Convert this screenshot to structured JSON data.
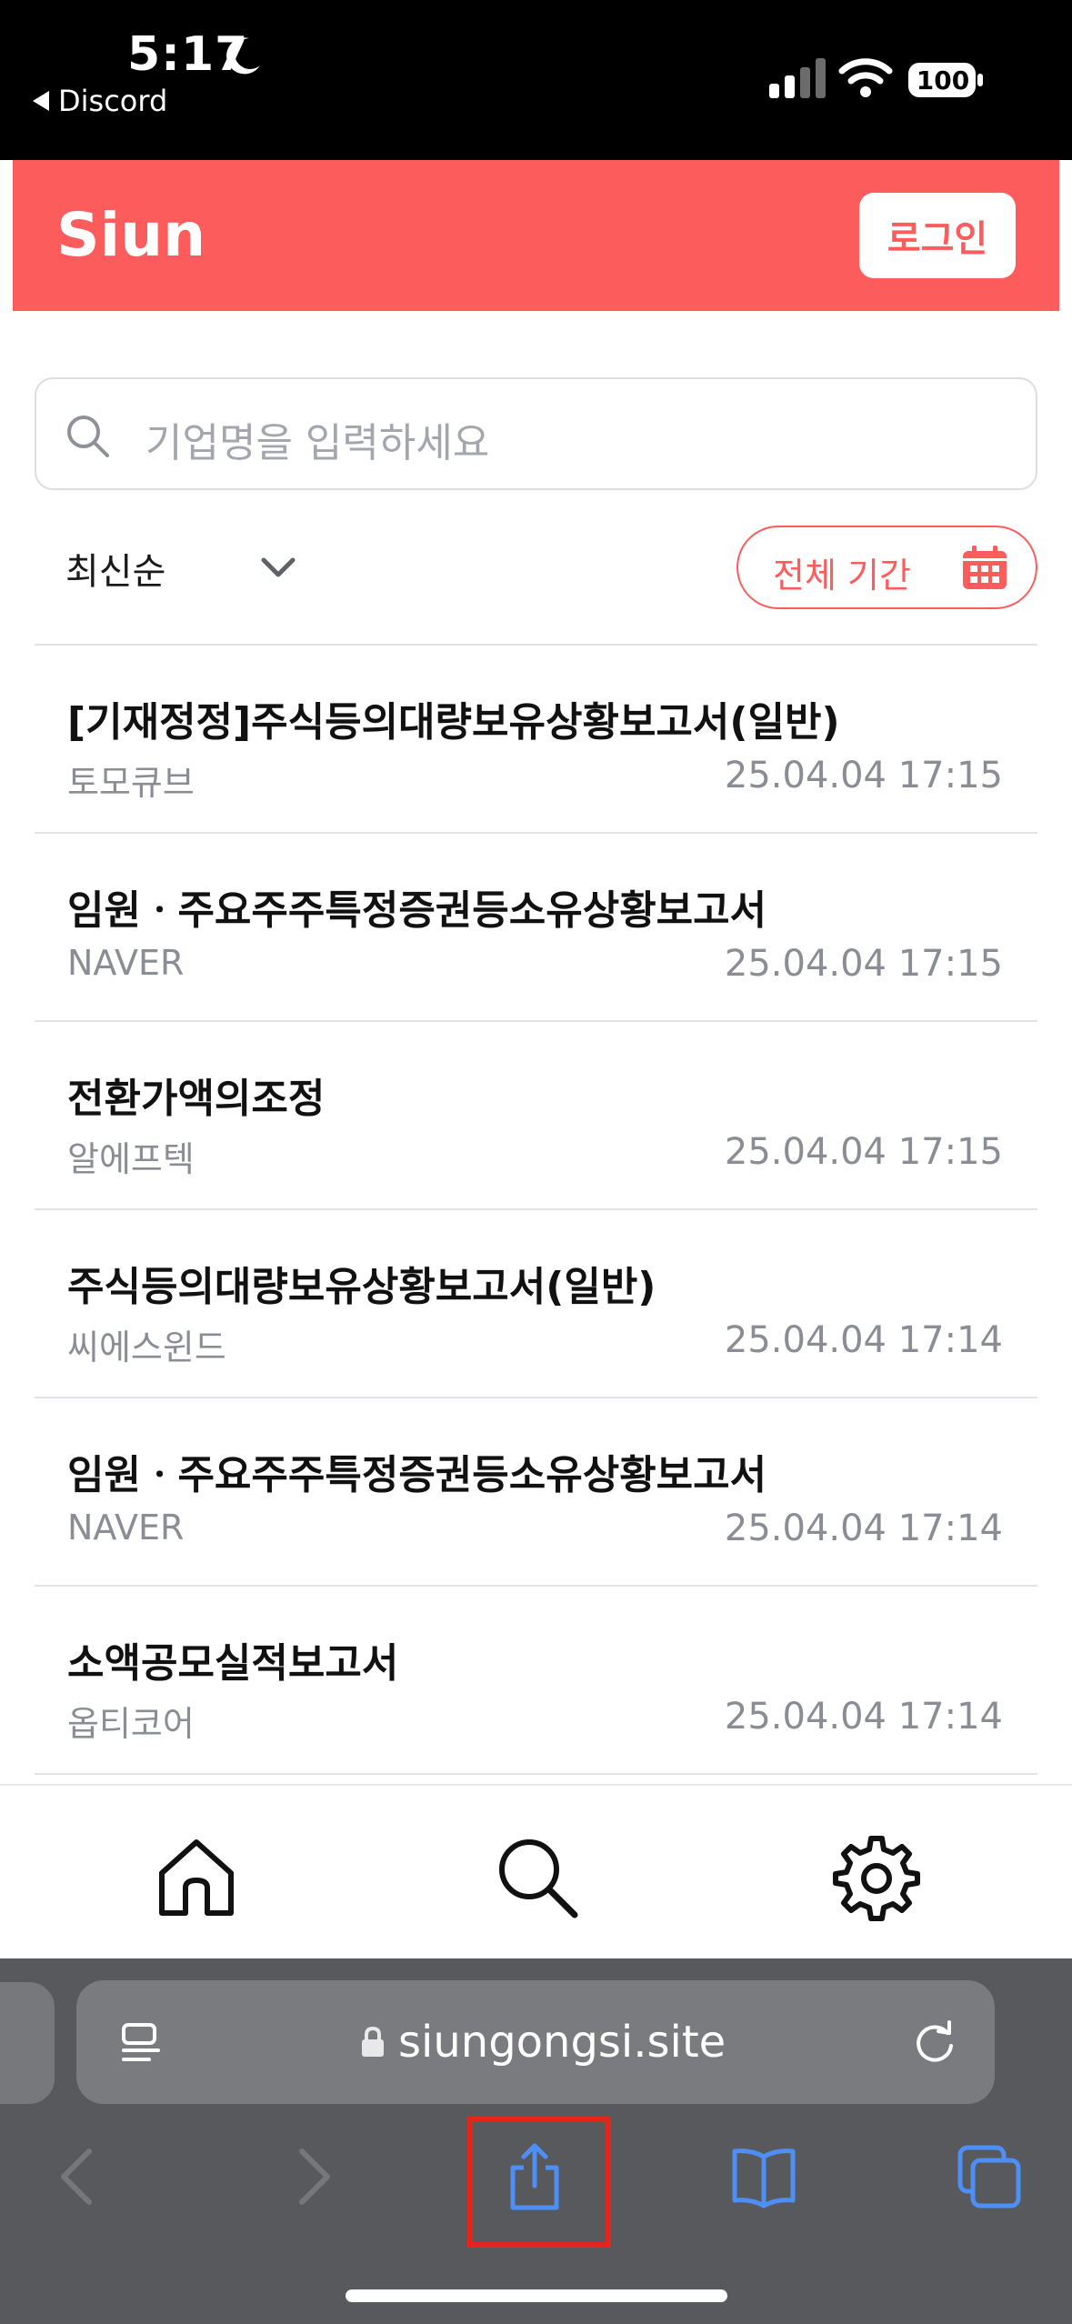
{
  "status_bar": {
    "time": "5:17",
    "back_app": "Discord",
    "battery": "100"
  },
  "header": {
    "logo": "Siun",
    "login_label": "로그인",
    "brand_color": "#fc5c5c"
  },
  "search": {
    "placeholder": "기업명을 입력하세요"
  },
  "filters": {
    "sort_label": "최신순",
    "period_label": "전체 기간"
  },
  "filings": [
    {
      "title": "[기재정정]주식등의대량보유상황보고서(일반)",
      "company": "토모큐브",
      "datetime": "25.04.04 17:15"
    },
    {
      "title": "임원ㆍ주요주주특정증권등소유상황보고서",
      "company": "NAVER",
      "datetime": "25.04.04 17:15"
    },
    {
      "title": "전환가액의조정",
      "company": "알에프텍",
      "datetime": "25.04.04 17:15"
    },
    {
      "title": "주식등의대량보유상황보고서(일반)",
      "company": "씨에스윈드",
      "datetime": "25.04.04 17:14"
    },
    {
      "title": "임원ㆍ주요주주특정증권등소유상황보고서",
      "company": "NAVER",
      "datetime": "25.04.04 17:14"
    },
    {
      "title": "소액공모실적보고서",
      "company": "옵티코어",
      "datetime": "25.04.04 17:14"
    }
  ],
  "tabbar": {
    "icons": [
      "home-icon",
      "search-icon",
      "gear-icon"
    ]
  },
  "browser": {
    "url": "siungongsi.site"
  }
}
